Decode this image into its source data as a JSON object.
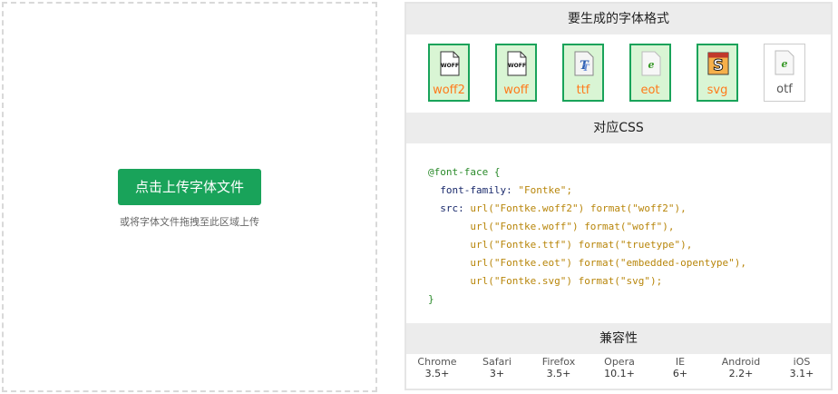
{
  "upload": {
    "button_label": "点击上传字体文件",
    "hint": "或将字体文件拖拽至此区域上传"
  },
  "panel": {
    "formats_title": "要生成的字体格式",
    "formats": [
      {
        "label": "woff2",
        "icon": "woff-file-icon",
        "selected": true
      },
      {
        "label": "woff",
        "icon": "woff-file-icon",
        "selected": true
      },
      {
        "label": "ttf",
        "icon": "ttf-file-icon",
        "selected": true
      },
      {
        "label": "eot",
        "icon": "eot-file-icon",
        "selected": true
      },
      {
        "label": "svg",
        "icon": "svg-file-icon",
        "selected": true
      },
      {
        "label": "otf",
        "icon": "otf-file-icon",
        "selected": false
      }
    ],
    "css_title": "对应CSS",
    "css": {
      "line1": "@font-face {",
      "line2_prop": "font-family:",
      "line2_val": "\"Fontke\";",
      "line3_prop": "src:",
      "line3_val": "url(\"Fontke.woff2\") format(\"woff2\"),",
      "line4": "url(\"Fontke.woff\") format(\"woff\"),",
      "line5": "url(\"Fontke.ttf\") format(\"truetype\"),",
      "line6": "url(\"Fontke.eot\") format(\"embedded-opentype\"),",
      "line7": "url(\"Fontke.svg\") format(\"svg\");",
      "line8": "}"
    },
    "compat_title": "兼容性",
    "compat": [
      {
        "browser": "Chrome",
        "version": "3.5+"
      },
      {
        "browser": "Safari",
        "version": "3+"
      },
      {
        "browser": "Firefox",
        "version": "3.5+"
      },
      {
        "browser": "Opera",
        "version": "10.1+"
      },
      {
        "browser": "IE",
        "version": "6+"
      },
      {
        "browser": "Android",
        "version": "2.2+"
      },
      {
        "browser": "iOS",
        "version": "3.1+"
      }
    ]
  },
  "colors": {
    "accent": "#19a35a",
    "selected_bg": "#d9f5d4",
    "format_label": "#ff7a1a"
  }
}
